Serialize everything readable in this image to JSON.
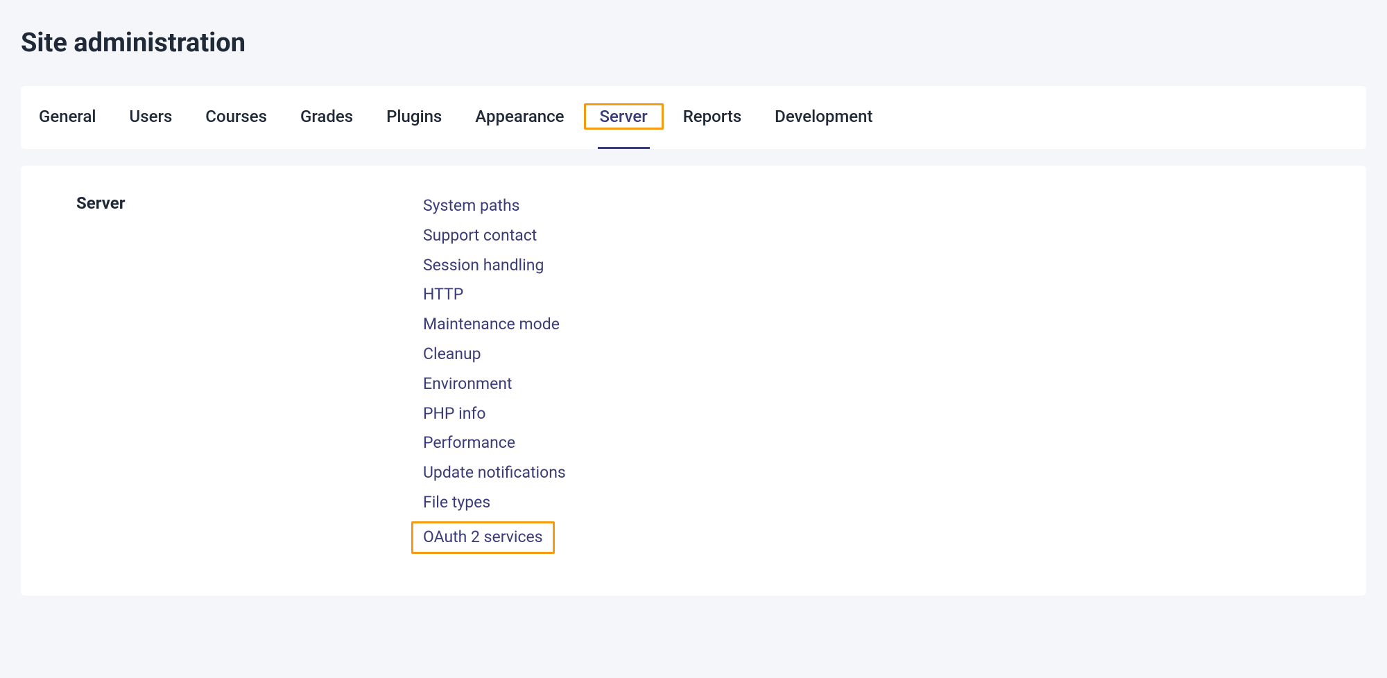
{
  "page": {
    "title": "Site administration"
  },
  "tabs": [
    {
      "label": "General",
      "active": false
    },
    {
      "label": "Users",
      "active": false
    },
    {
      "label": "Courses",
      "active": false
    },
    {
      "label": "Grades",
      "active": false
    },
    {
      "label": "Plugins",
      "active": false
    },
    {
      "label": "Appearance",
      "active": false
    },
    {
      "label": "Server",
      "active": true
    },
    {
      "label": "Reports",
      "active": false
    },
    {
      "label": "Development",
      "active": false
    }
  ],
  "section": {
    "title": "Server",
    "links": [
      {
        "label": "System paths",
        "highlighted": false
      },
      {
        "label": "Support contact",
        "highlighted": false
      },
      {
        "label": "Session handling",
        "highlighted": false
      },
      {
        "label": "HTTP",
        "highlighted": false
      },
      {
        "label": "Maintenance mode",
        "highlighted": false
      },
      {
        "label": "Cleanup",
        "highlighted": false
      },
      {
        "label": "Environment",
        "highlighted": false
      },
      {
        "label": "PHP info",
        "highlighted": false
      },
      {
        "label": "Performance",
        "highlighted": false
      },
      {
        "label": "Update notifications",
        "highlighted": false
      },
      {
        "label": "File types",
        "highlighted": false
      },
      {
        "label": "OAuth 2 services",
        "highlighted": true
      }
    ]
  }
}
